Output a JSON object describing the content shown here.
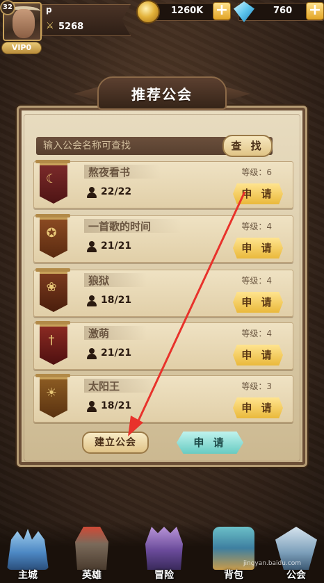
{
  "player": {
    "level": "32",
    "name": "p",
    "power": "5268",
    "vip": "VIP0"
  },
  "resources": {
    "gold": "1260K",
    "gems": "760"
  },
  "panel": {
    "title": "推荐公会",
    "search_placeholder": "输入公会名称可查找",
    "search_label": "查 找",
    "guilds": [
      {
        "name": "熬夜看书",
        "members": "22/22",
        "level": "等级：6",
        "apply": "申 请",
        "icon": "crescent-moon"
      },
      {
        "name": "一首歌的时间",
        "members": "21/21",
        "level": "等级：4",
        "apply": "申 请",
        "icon": "star-medal"
      },
      {
        "name": "狼狱",
        "members": "18/21",
        "level": "等级：4",
        "apply": "申 请",
        "icon": "paw-print"
      },
      {
        "name": "激萌",
        "members": "21/21",
        "level": "等级：4",
        "apply": "申 请",
        "icon": "sword"
      },
      {
        "name": "太阳王",
        "members": "18/21",
        "level": "等级：3",
        "apply": "申 请",
        "icon": "sun"
      }
    ],
    "create_label": "建立公会",
    "apply_label": "申 请"
  },
  "nav": [
    {
      "label": "主城",
      "icon": "castle"
    },
    {
      "label": "英雄",
      "icon": "hero-helmet"
    },
    {
      "label": "冒险",
      "icon": "adventure-gate"
    },
    {
      "label": "背包",
      "icon": "treasure-chest"
    },
    {
      "label": "公会",
      "icon": "guild-shield"
    }
  ],
  "watermark": "jingyan.baidu.com",
  "colors": {
    "panel": "#e0d0ae",
    "apply_button": "#f0c24a",
    "annotation_arrow": "#e8322b"
  }
}
